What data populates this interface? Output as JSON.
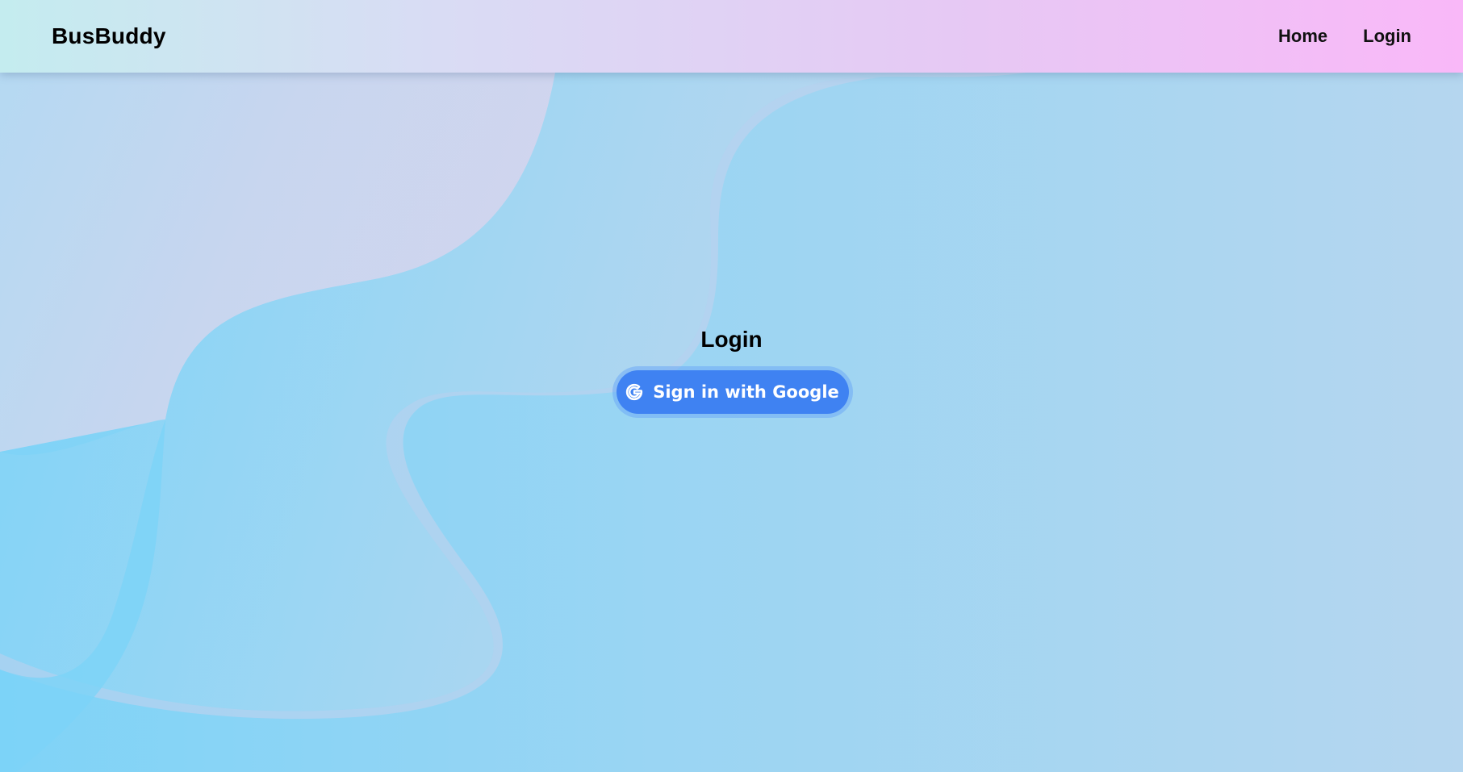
{
  "navbar": {
    "brand": "BusBuddy",
    "links": [
      {
        "label": "Home"
      },
      {
        "label": "Login"
      }
    ]
  },
  "login": {
    "title": "Login",
    "google_button": {
      "label": "Sign in with Google",
      "icon": "google-g-icon"
    }
  },
  "colors": {
    "button_bg": "#3f82f2",
    "button_text": "#ffffff",
    "navbar_gradient_start": "#c4ecef",
    "navbar_gradient_end": "#f9b8f8",
    "background_blue": "#7fd3f7",
    "wave_lavender": "#d3d3ec"
  }
}
